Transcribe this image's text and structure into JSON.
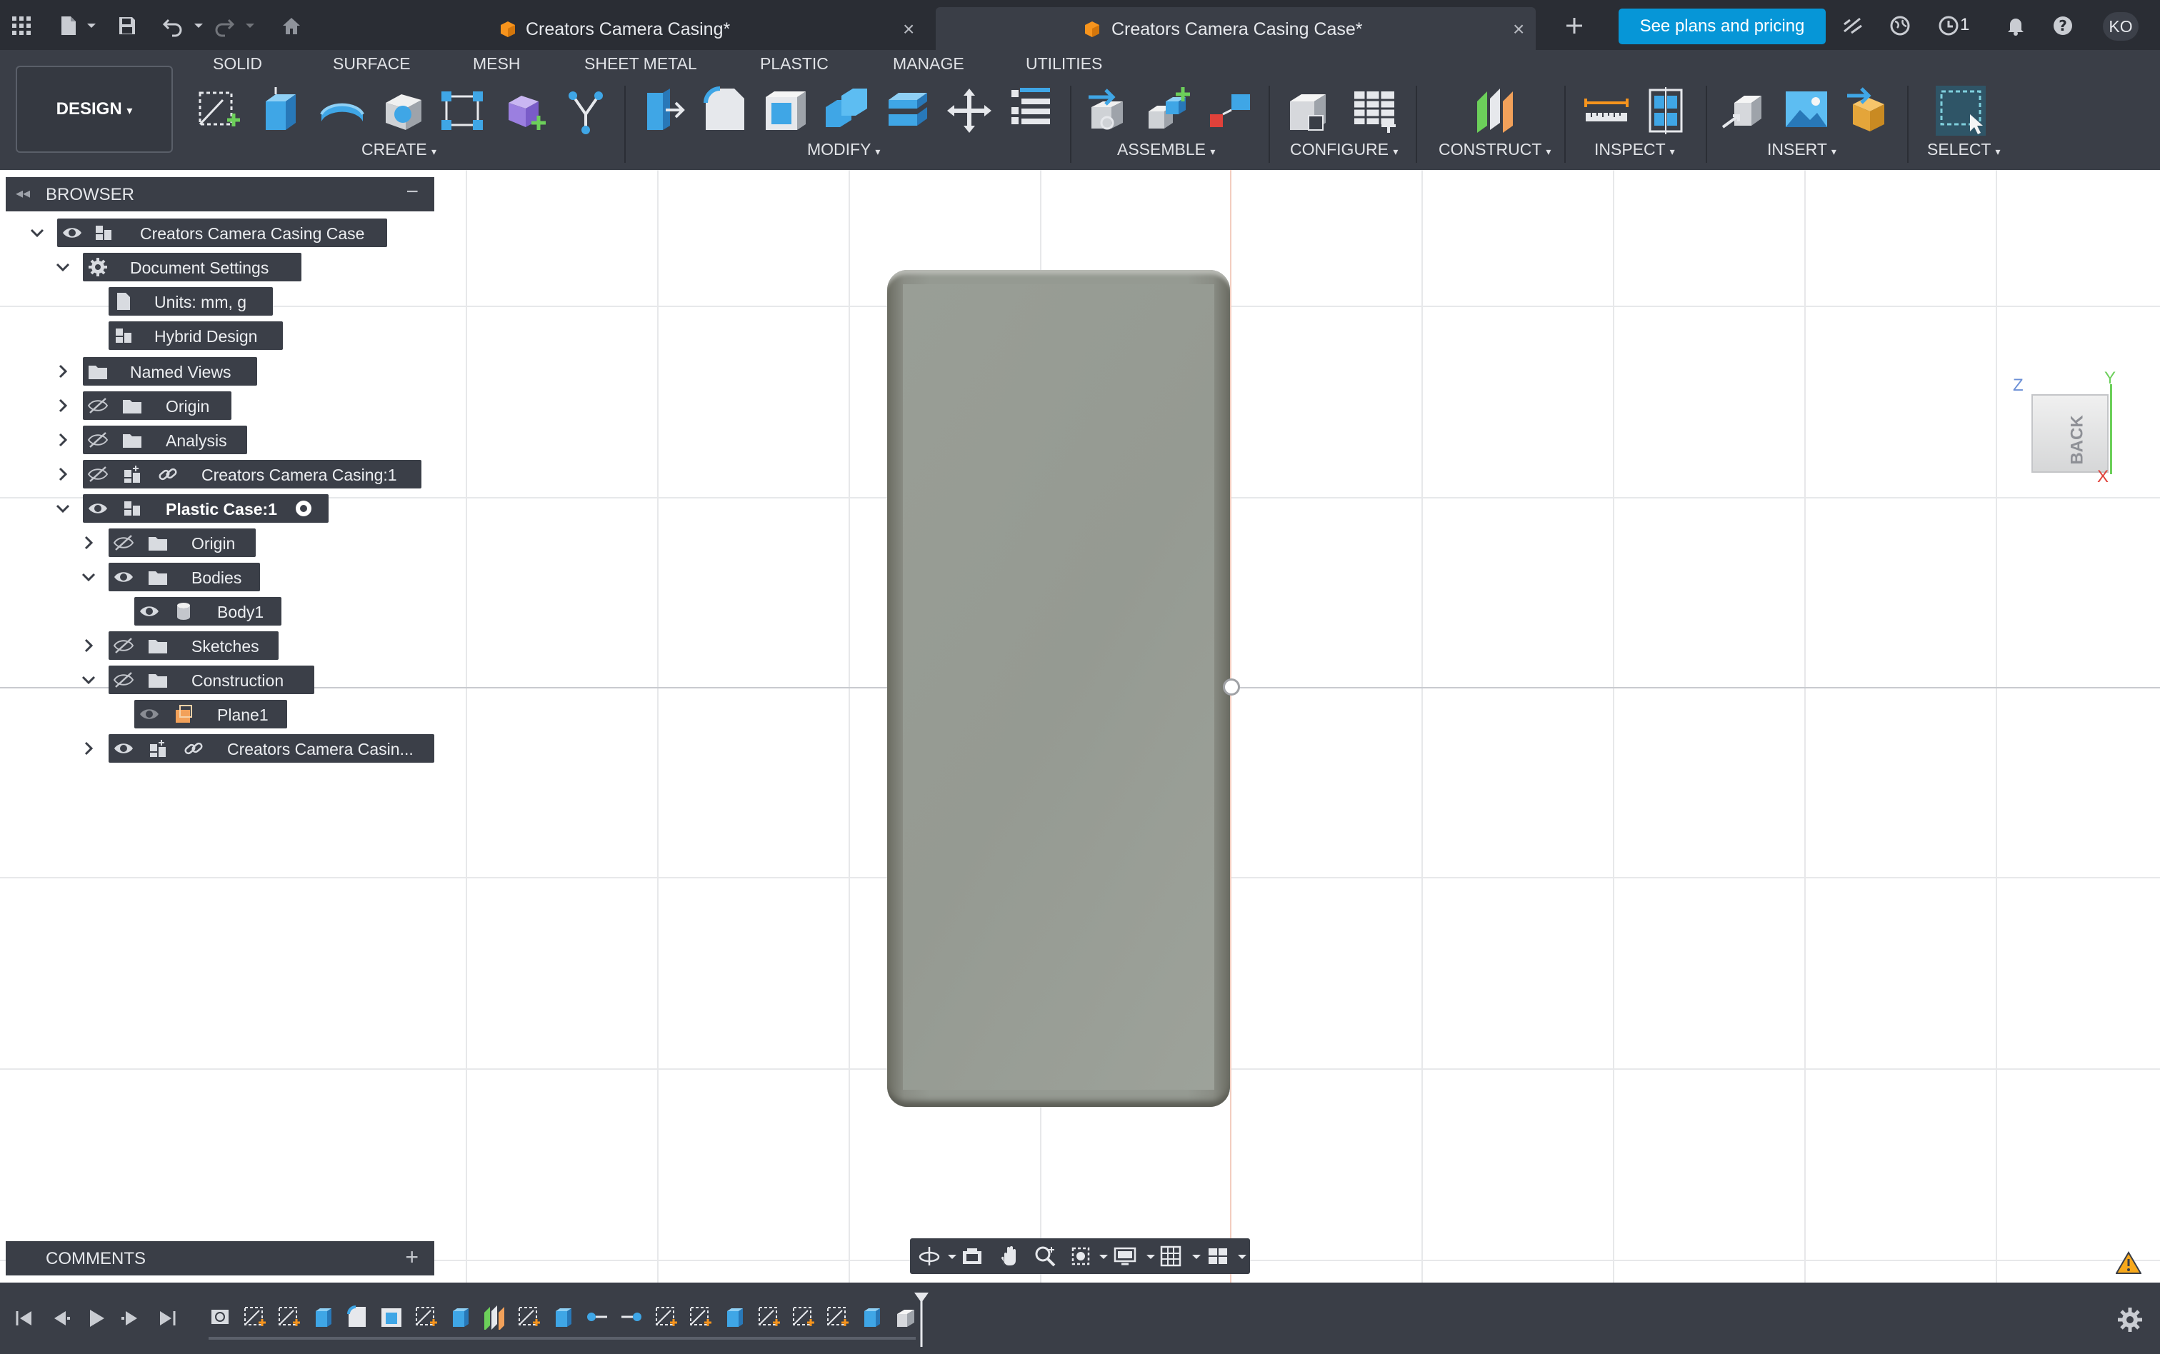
{
  "app": {
    "tabs": [
      {
        "label": "Creators Camera Casing*",
        "active": false,
        "close": "×"
      },
      {
        "label": "Creators Camera Casing Case*",
        "active": true,
        "close": "×"
      }
    ],
    "plans_button": "See plans and pricing",
    "job_count": "1",
    "user_initials": "KO"
  },
  "toolbar": {
    "workspace": "DESIGN",
    "workspace_tabs": [
      "SOLID",
      "SURFACE",
      "MESH",
      "SHEET METAL",
      "PLASTIC",
      "MANAGE",
      "UTILITIES"
    ],
    "groups": [
      "CREATE",
      "MODIFY",
      "ASSEMBLE",
      "CONFIGURE",
      "CONSTRUCT",
      "INSPECT",
      "INSERT",
      "SELECT"
    ]
  },
  "browser": {
    "title": "BROWSER",
    "items": [
      {
        "label": "Creators Camera Casing Case"
      },
      {
        "label": "Document Settings"
      },
      {
        "label": "Units: mm, g"
      },
      {
        "label": "Hybrid Design"
      },
      {
        "label": "Named Views"
      },
      {
        "label": "Origin"
      },
      {
        "label": "Analysis"
      },
      {
        "label": "Creators Camera Casing:1"
      },
      {
        "label": "Plastic Case:1"
      },
      {
        "label": "Origin"
      },
      {
        "label": "Bodies"
      },
      {
        "label": "Body1"
      },
      {
        "label": "Sketches"
      },
      {
        "label": "Construction"
      },
      {
        "label": "Plane1"
      },
      {
        "label": "Creators Camera Casin..."
      }
    ]
  },
  "viewcube": {
    "face": "BACK",
    "axes": {
      "z": "Z",
      "y": "Y",
      "x": "X"
    }
  },
  "comments": {
    "title": "COMMENTS"
  },
  "colors": {
    "accent": "#0696d7",
    "panel": "#3a3e47",
    "topbar": "#2a2d34",
    "body": "#959a92",
    "orange": "#f7941d",
    "green": "#7ed06b"
  }
}
